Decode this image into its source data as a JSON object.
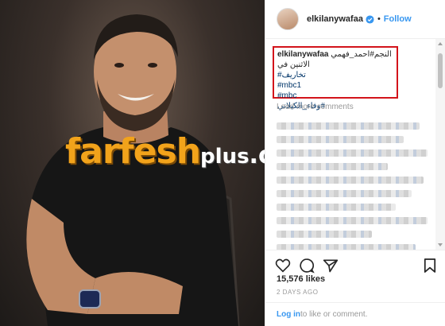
{
  "watermark": {
    "main": "farfesh",
    "plus": "plus",
    "com": ".com"
  },
  "header": {
    "username": "elkilanywafaa",
    "dot": "•",
    "follow_label": "Follow"
  },
  "caption": {
    "username": "elkilanywafaa",
    "text": "النجم#احمد_فهمي الاثنين في",
    "tags": [
      "#تخاريف",
      "#mbc1",
      "#mbc",
      "وفاء_الكيلاني#"
    ]
  },
  "comments": {
    "load_more": "Load more comments"
  },
  "actions": {
    "likes": "15,576 likes",
    "date": "2 DAYS AGO"
  },
  "footer": {
    "login": "Log in",
    "rest": " to like or comment."
  },
  "colors": {
    "link": "#3897f0",
    "highlight_box": "#d3141b",
    "watermark": "#f2a31b"
  }
}
